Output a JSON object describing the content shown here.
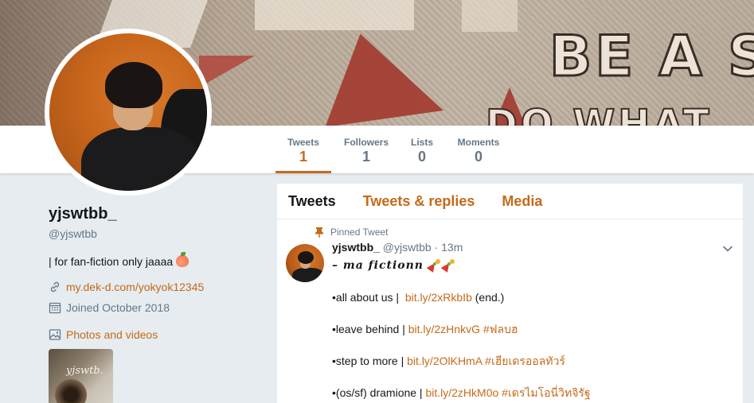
{
  "banner": {
    "text_line1": "BE A S",
    "text_line2": "DO WHAT"
  },
  "stats": [
    {
      "label": "Tweets",
      "value": "1"
    },
    {
      "label": "Followers",
      "value": "1"
    },
    {
      "label": "Lists",
      "value": "0"
    },
    {
      "label": "Moments",
      "value": "0"
    }
  ],
  "profile": {
    "name": "yjswtbb_",
    "handle": "@yjswtbb",
    "bio": "| for fan-fiction only jaaaa",
    "website": "my.dek-d.com/yokyok12345",
    "joined": "Joined October 2018",
    "photos_label": "Photos and videos",
    "thumb_text": "yjswtb."
  },
  "tabs": [
    "Tweets",
    "Tweets & replies",
    "Media"
  ],
  "tweet": {
    "pinned_label": "Pinned Tweet",
    "name": "yjswtbb_",
    "handle_time": "@yjswtbb · 13m",
    "first_line": "– ma fictionn",
    "lines": [
      {
        "prefix": "•all about us |  ",
        "link": "bit.ly/2xRkbIb",
        "suffix": " (end.)"
      },
      {
        "prefix": "•leave behind | ",
        "link": "bit.ly/2zHnkvG #ฟลบฮ",
        "suffix": ""
      },
      {
        "prefix": "•step to more | ",
        "link": "bit.ly/2OlKHmA #เฮียเดรออลทัวร์",
        "suffix": ""
      },
      {
        "prefix": "•(os/sf) dramione | ",
        "link": "bit.ly/2zHkM0o #เดรไมโอนี่วิทจิรัฐ",
        "suffix": ""
      }
    ]
  },
  "icons": {
    "link": "link-icon",
    "calendar": "calendar-icon",
    "photos": "image-icon",
    "pin": "pin-icon",
    "chevron": "chevron-down-icon"
  },
  "colors": {
    "accent": "#c56a1a",
    "muted": "#657786",
    "background": "#e6ecf0"
  }
}
